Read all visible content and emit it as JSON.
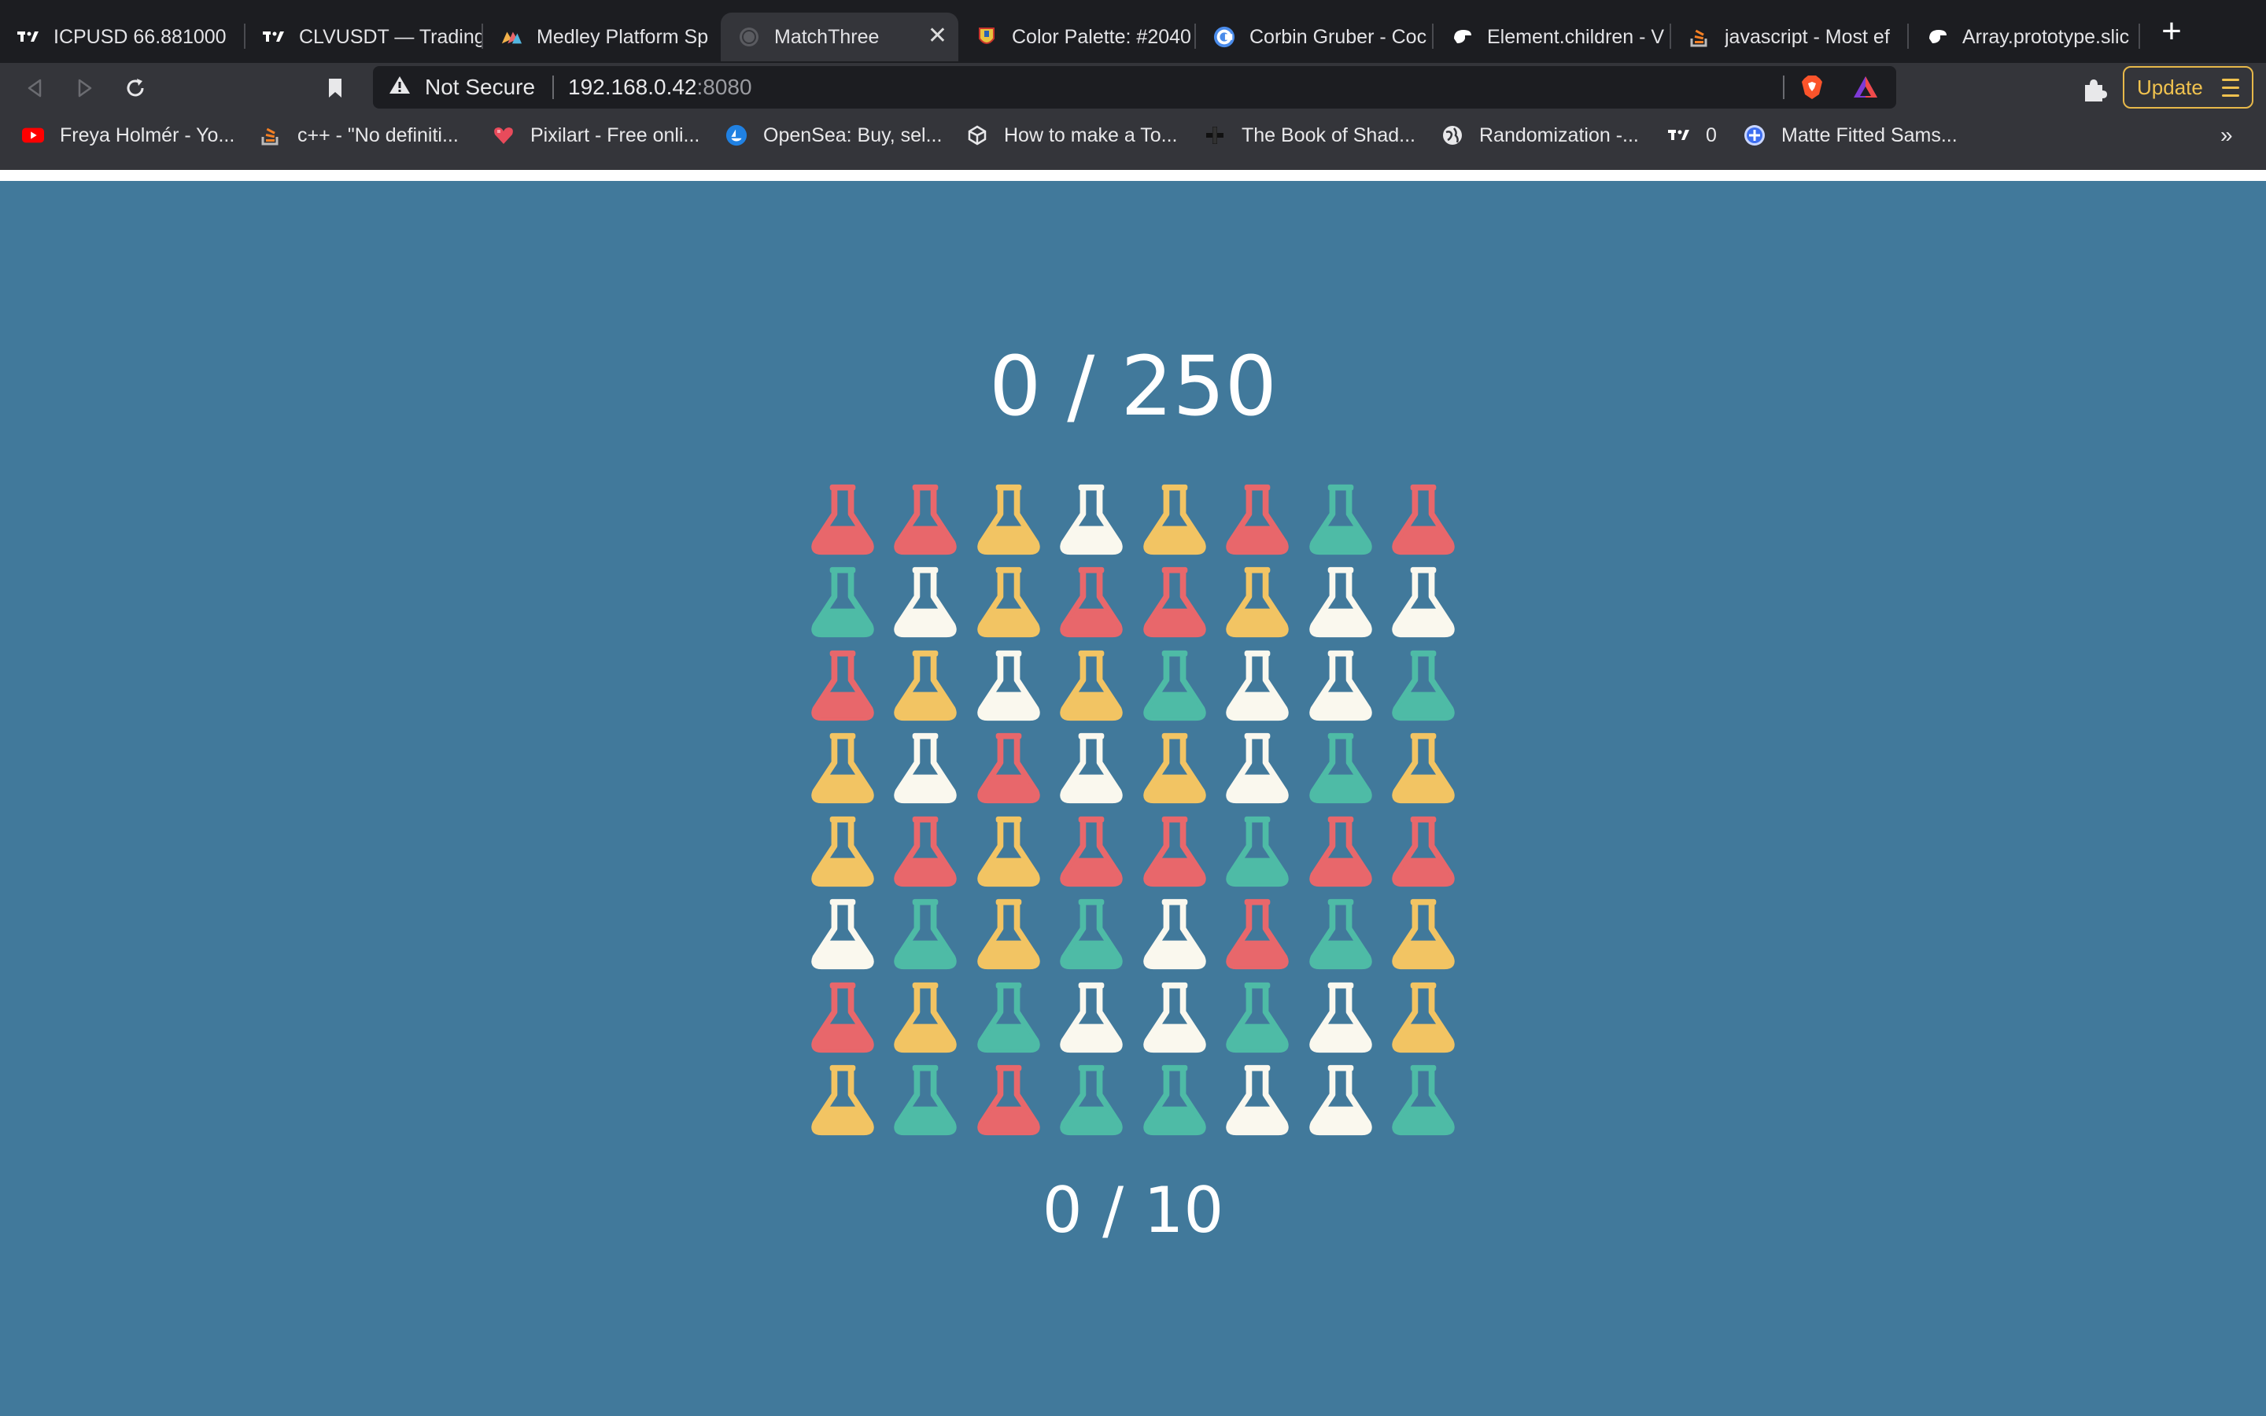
{
  "browser": {
    "tabs": [
      {
        "title": "ICPUSD 66.881000",
        "icon": "tradingview-icon"
      },
      {
        "title": "CLVUSDT — Trading",
        "icon": "tradingview-icon"
      },
      {
        "title": "Medley Platform Sp",
        "icon": "medley-icon"
      },
      {
        "title": "MatchThree",
        "icon": "globe-icon",
        "active": true
      },
      {
        "title": "Color Palette: #2040",
        "icon": "palette-icon"
      },
      {
        "title": "Corbin Gruber - Coc",
        "icon": "c-logo-icon"
      },
      {
        "title": "Element.children - V",
        "icon": "mdn-icon"
      },
      {
        "title": "javascript - Most ef",
        "icon": "stackoverflow-icon"
      },
      {
        "title": "Array.prototype.slic",
        "icon": "mdn-icon"
      }
    ],
    "address": {
      "security": "Not Secure",
      "host": "192.168.0.42",
      "port": ":8080"
    },
    "update_label": "Update",
    "bookmarks": [
      {
        "label": "Freya Holmér - Yo...",
        "icon": "youtube-icon"
      },
      {
        "label": "c++ - \"No definiti...",
        "icon": "stackoverflow-icon"
      },
      {
        "label": "Pixilart - Free onli...",
        "icon": "pixilart-icon"
      },
      {
        "label": "OpenSea: Buy, sel...",
        "icon": "opensea-icon"
      },
      {
        "label": "How to make a To...",
        "icon": "unity-icon"
      },
      {
        "label": "The Book of Shad...",
        "icon": "plus-icon"
      },
      {
        "label": "Randomization -...",
        "icon": "globe-icon"
      },
      {
        "label": "0",
        "icon": "tradingview-icon"
      },
      {
        "label": "Matte Fitted Sams...",
        "icon": "plus-circle-icon"
      }
    ],
    "more_label": "»"
  },
  "game": {
    "score": "0 / 250",
    "moves": "0 / 10",
    "colors": {
      "red": "#e8676b",
      "yellow": "#f2c463",
      "white": "#faf8ee",
      "teal": "#4ebba6"
    },
    "board": [
      [
        "red",
        "red",
        "yellow",
        "white",
        "yellow",
        "red",
        "teal",
        "red"
      ],
      [
        "teal",
        "white",
        "yellow",
        "red",
        "red",
        "yellow",
        "white",
        "white"
      ],
      [
        "red",
        "yellow",
        "white",
        "yellow",
        "teal",
        "white",
        "white",
        "teal"
      ],
      [
        "yellow",
        "white",
        "red",
        "white",
        "yellow",
        "white",
        "teal",
        "yellow"
      ],
      [
        "yellow",
        "red",
        "yellow",
        "red",
        "red",
        "teal",
        "red",
        "red"
      ],
      [
        "white",
        "teal",
        "yellow",
        "teal",
        "white",
        "red",
        "teal",
        "yellow"
      ],
      [
        "red",
        "yellow",
        "teal",
        "white",
        "white",
        "teal",
        "white",
        "yellow"
      ],
      [
        "yellow",
        "teal",
        "red",
        "teal",
        "teal",
        "white",
        "white",
        "teal"
      ]
    ]
  }
}
